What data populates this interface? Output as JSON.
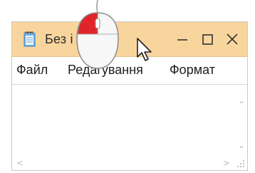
{
  "window": {
    "title": "Без і",
    "title_suffix": ".",
    "titlebar_color": "#f9d59e"
  },
  "menu": {
    "items": [
      "Файл",
      "Редагування",
      "Формат"
    ]
  },
  "icons": {
    "app": "notepad-icon",
    "minimize": "minimize-icon",
    "maximize": "maximize-icon",
    "close": "close-icon",
    "mouse": "mouse-left-click-icon",
    "cursor": "pointer-cursor-icon"
  },
  "accent": {
    "mouse_button": "#e0242a"
  }
}
